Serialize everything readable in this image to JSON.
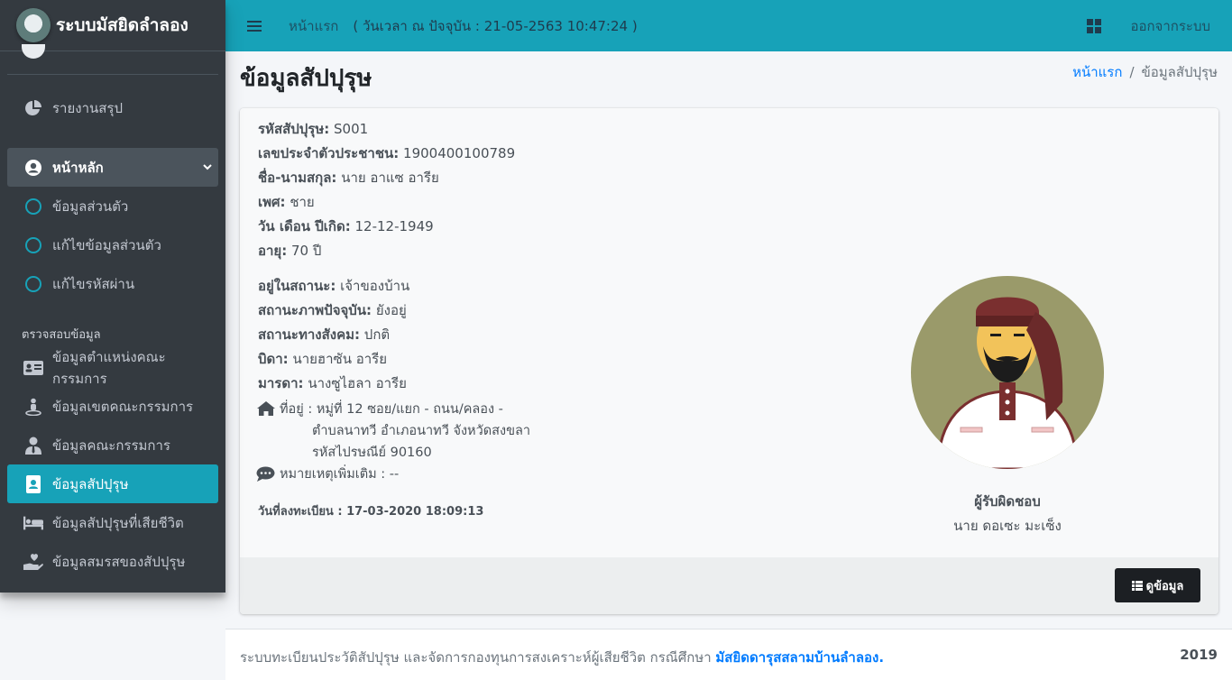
{
  "brand": {
    "title": "ระบบมัสยิดลำลอง"
  },
  "topbar": {
    "home_link": "หน้าแรก",
    "time_text": "( วันเวลา ณ ปัจจุบัน : 21-05-2563 10:47:24 )",
    "logout": "ออกจากระบบ"
  },
  "sidebar": {
    "report": "รายงานสรุป",
    "main_menu": "หน้าหลัก",
    "sub": [
      "ข้อมูลส่วนตัว",
      "แก้ไขข้อมูลส่วนตัว",
      "แก้ไขรหัสผ่าน"
    ],
    "section_header": "ตรวจสอบข้อมูล",
    "items": [
      "ข้อมูลตำแหน่งคณะกรรมการ",
      "ข้อมูลเขตคณะกรรมการ",
      "ข้อมูลคณะกรรมการ",
      "ข้อมูลสัปปุรุษ",
      "ข้อมูลสัปปุรุษที่เสียชีวิต",
      "ข้อมูลสมรสของสัปปุรุษ"
    ]
  },
  "page": {
    "title": "ข้อมูลสัปปุรุษ",
    "breadcrumb_home": "หน้าแรก",
    "breadcrumb_current": "ข้อมูลสัปปุรุษ"
  },
  "person": {
    "code_label": "รหัสสัปปุรุษ:",
    "code": "S001",
    "idcard_label": "เลขประจำตัวประชาชน:",
    "idcard": "1900400100789",
    "name_label": "ชื่อ-นามสกุล:",
    "name": "นาย อาแซ อารีย",
    "sex_label": "เพศ:",
    "sex": "ชาย",
    "birth_label": "วัน เดือน ปีเกิด:",
    "birth": "12-12-1949",
    "age_label": "อายุ:",
    "age": "70 ปี",
    "status_label": "อยู่ในสถานะ:",
    "status": "เจ้าของบ้าน",
    "current_label": "สถานะภาพปัจจุบัน:",
    "current": "ยังอยู่",
    "social_label": "สถานะทางสังคม:",
    "social": "ปกติ",
    "father_label": "บิดา:",
    "father": "นายฮาซัน อารีย",
    "mother_label": "มารดา:",
    "mother": "นางซูไฮลา อารีย",
    "address_line1": "ที่อยู่ : หมู่ที่ 12 ซอย/แยก - ถนน/คลอง -",
    "address_line2": "ตำบลนาทวี อำเภอนาทวี จังหวัดสงขลา",
    "address_line3": "รหัสไปรษณีย์ 90160",
    "note": "หมายเหตุเพิ่มเติม : --",
    "register_date": "วันที่ลงทะเบียน : 17-03-2020 18:09:13"
  },
  "responsible": {
    "title": "ผู้รับผิดชอบ",
    "name": "นาย ดอเซะ มะเซ็ง"
  },
  "actions": {
    "view": "ดูข้อมูล"
  },
  "footer": {
    "text": "ระบบทะเบียนประวัติสัปปุรุษ และจัดการกองทุนการสงเคราะห์ผู้เสียชีวิต กรณีศึกษา",
    "link": "มัสยิดดารุสสลามบ้านลำลอง.",
    "year": "2019"
  },
  "colors": {
    "accent": "#17a2b8",
    "sidebar": "#343a40",
    "link": "#007bff"
  }
}
